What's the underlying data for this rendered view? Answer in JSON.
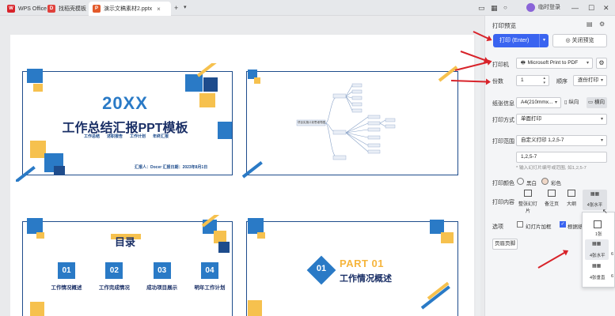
{
  "tabs": [
    {
      "label": "WPS Office",
      "active": false
    },
    {
      "label": "找稻壳模板",
      "active": false
    },
    {
      "label": "演示文稿素材2.pptx",
      "active": true
    }
  ],
  "new_tab": "+",
  "user": {
    "name": "临时登录"
  },
  "panel": {
    "title": "打印预览",
    "print_button": "打印 (Enter)",
    "close_button": "关闭预览",
    "printer_label": "打印机",
    "printer_value": "Microsoft Print to PDF",
    "copies_label": "份数",
    "copies_value": "1",
    "order_label": "顺序",
    "order_value": "逐份打印",
    "paper_label": "纸张信息",
    "paper_value": "A4(210mmx...",
    "portrait": "纵向",
    "landscape": "横向",
    "method_label": "打印方式",
    "method_value": "单面打印",
    "range_label": "打印范围",
    "range_value": "自定义打印 1,2,5-7",
    "range_input": "1,2,5-7",
    "range_hint": "* 输入幻灯片编号或范围, 如1,2,5-7",
    "color_label": "打印颜色",
    "color_bw": "黑白",
    "color_color": "彩色",
    "content_label": "打印内容",
    "content_items": [
      "整张幻灯片",
      "备注页",
      "大纲",
      "4张水平"
    ],
    "options_label": "选项",
    "frame_slides": "幻灯片加框",
    "fit_paper": "根据纸",
    "header_footer": "页眉页脚",
    "layout_popup": [
      "1张",
      "4张水平",
      "4张垂直"
    ],
    "layout_popup_side": [
      "6",
      "6"
    ]
  },
  "slides": {
    "s1_year": "20XX",
    "s1_title": "工作总结汇报PPT模板",
    "s1_tags": [
      "工作总结",
      "述职报告",
      "工作计划",
      "年终汇报"
    ],
    "s1_footer": "汇报人：Docer   汇报日期：2023年8月1日",
    "s2_root": "项目实施计划思维导图",
    "s3_title": "目录",
    "s3_items": [
      {
        "num": "01",
        "label": "工作情况概述"
      },
      {
        "num": "02",
        "label": "工作完成情况"
      },
      {
        "num": "03",
        "label": "成功项目展示"
      },
      {
        "num": "04",
        "label": "明年工作计划"
      }
    ],
    "s4_num": "01",
    "s4_part": "PART 01",
    "s4_title": "工作情况概述"
  },
  "colors": {
    "blue": "#2a7ac6",
    "dark_blue": "#1e4c8c",
    "yellow": "#f6c14e",
    "accent": "#3a64f0",
    "red": "#d8232a"
  }
}
